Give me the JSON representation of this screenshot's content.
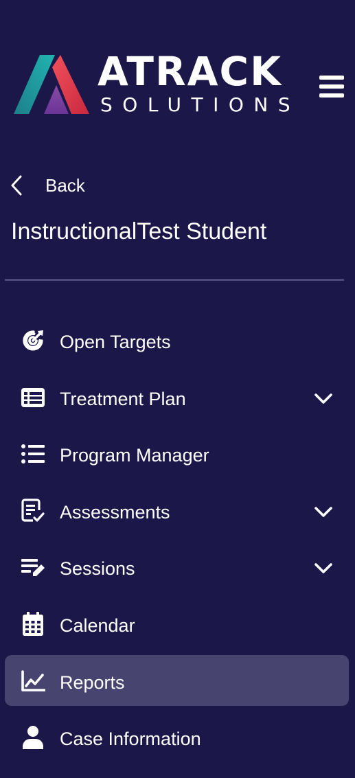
{
  "brand": {
    "title": "ATRACK",
    "subtitle": "SOLUTIONS",
    "colors": {
      "teal": "#1fa3a6",
      "red": "#e43a4c",
      "purple": "#7a3fa0"
    }
  },
  "header": {
    "menu_icon": "hamburger-icon"
  },
  "back": {
    "label": "Back",
    "icon": "chevron-left-icon"
  },
  "student": {
    "name": "InstructionalTest Student"
  },
  "nav": {
    "items": [
      {
        "label": "Open Targets",
        "icon": "target-icon",
        "expandable": false,
        "active": false
      },
      {
        "label": "Treatment Plan",
        "icon": "list-table-icon",
        "expandable": true,
        "active": false
      },
      {
        "label": "Program Manager",
        "icon": "bullet-list-icon",
        "expandable": false,
        "active": false
      },
      {
        "label": "Assessments",
        "icon": "checklist-doc-icon",
        "expandable": true,
        "active": false
      },
      {
        "label": "Sessions",
        "icon": "edit-list-icon",
        "expandable": true,
        "active": false
      },
      {
        "label": "Calendar",
        "icon": "calendar-icon",
        "expandable": false,
        "active": false
      },
      {
        "label": "Reports",
        "icon": "line-chart-icon",
        "expandable": false,
        "active": true
      },
      {
        "label": "Case Information",
        "icon": "user-icon",
        "expandable": false,
        "active": false
      }
    ]
  },
  "colors": {
    "background": "#1b1748",
    "active_item": "#474470",
    "divider": "#4c4a78",
    "text": "#ffffff"
  }
}
